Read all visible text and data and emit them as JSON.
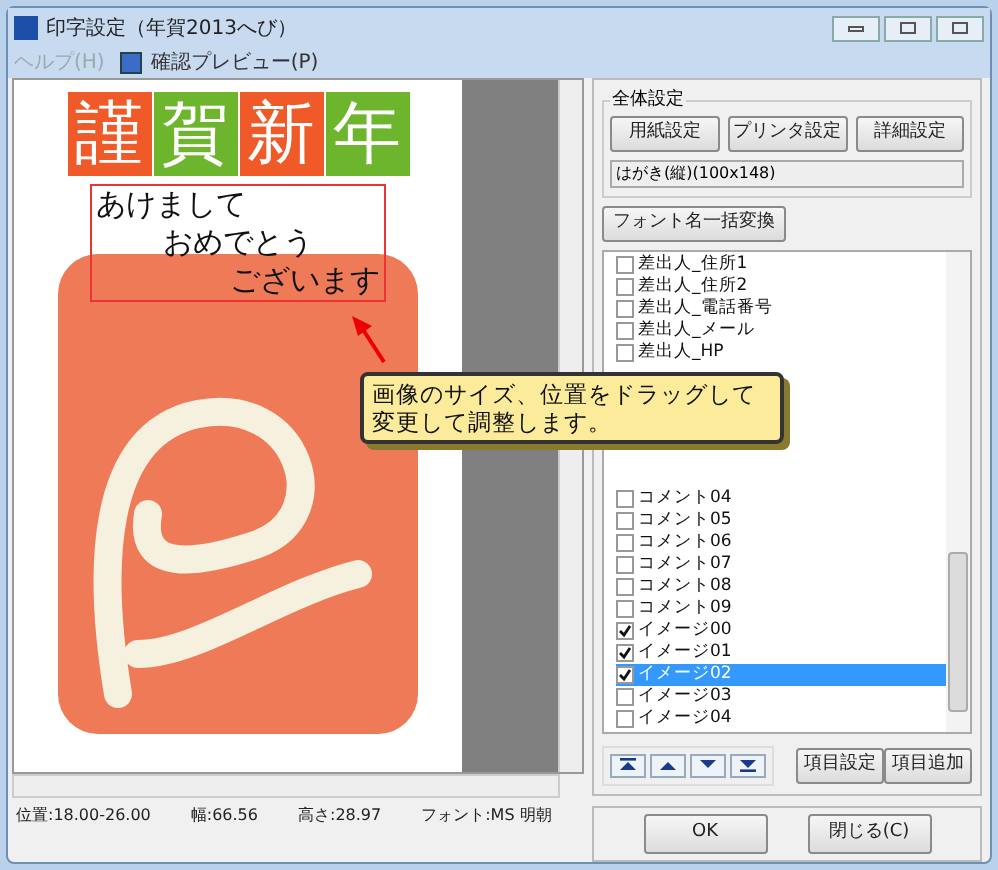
{
  "window": {
    "title": "印字設定（年賀2013へび）"
  },
  "menu": [
    {
      "label": "ヘルプ(H)",
      "kind": "text",
      "disabled": true
    },
    {
      "label": "確認プレビュー(P)",
      "kind": "icon",
      "disabled": false
    }
  ],
  "card": {
    "tiles": [
      {
        "label": "謹",
        "color": "#f05a28"
      },
      {
        "label": "賀",
        "color": "#6cb52d"
      },
      {
        "label": "新",
        "color": "#f05a28"
      },
      {
        "label": "年",
        "color": "#6cb52d"
      }
    ],
    "greeting": [
      "あけまして",
      "おめでとう",
      "ございます"
    ]
  },
  "tooltip": {
    "text": "画像のサイズ、位置をドラッグして変更して調整します。"
  },
  "status": {
    "position": "位置:18.00-26.00",
    "width": "幅:66.56",
    "height": "高さ:28.97",
    "font": "フォント:MS 明朝"
  },
  "settings": {
    "group_title": "全体設定",
    "buttons": [
      "用紙設定",
      "プリンタ設定",
      "詳細設定"
    ],
    "paper": "はがき(縦)(100x148)"
  },
  "font_button": "フォント名一括変換",
  "items": [
    {
      "label": "差出人_住所1",
      "checked": false,
      "selected": false
    },
    {
      "label": "差出人_住所2",
      "checked": false,
      "selected": false
    },
    {
      "label": "差出人_電話番号",
      "checked": false,
      "selected": false
    },
    {
      "label": "差出人_メール",
      "checked": false,
      "selected": false
    },
    {
      "label": "差出人_HP",
      "checked": false,
      "selected": false
    },
    {
      "kind": "hidden"
    },
    {
      "label": "コメント04",
      "checked": false,
      "selected": false
    },
    {
      "label": "コメント05",
      "checked": false,
      "selected": false
    },
    {
      "label": "コメント06",
      "checked": false,
      "selected": false
    },
    {
      "label": "コメント07",
      "checked": false,
      "selected": false
    },
    {
      "label": "コメント08",
      "checked": false,
      "selected": false
    },
    {
      "label": "コメント09",
      "checked": false,
      "selected": false
    },
    {
      "label": "イメージ00",
      "checked": true,
      "selected": false
    },
    {
      "label": "イメージ01",
      "checked": true,
      "selected": false
    },
    {
      "label": "イメージ02",
      "checked": true,
      "selected": true
    },
    {
      "label": "イメージ03",
      "checked": false,
      "selected": false
    },
    {
      "label": "イメージ04",
      "checked": false,
      "selected": false
    }
  ],
  "item_buttons": [
    "項目設定",
    "項目追加"
  ],
  "footer_buttons": [
    "OK",
    "閉じる(C)"
  ]
}
